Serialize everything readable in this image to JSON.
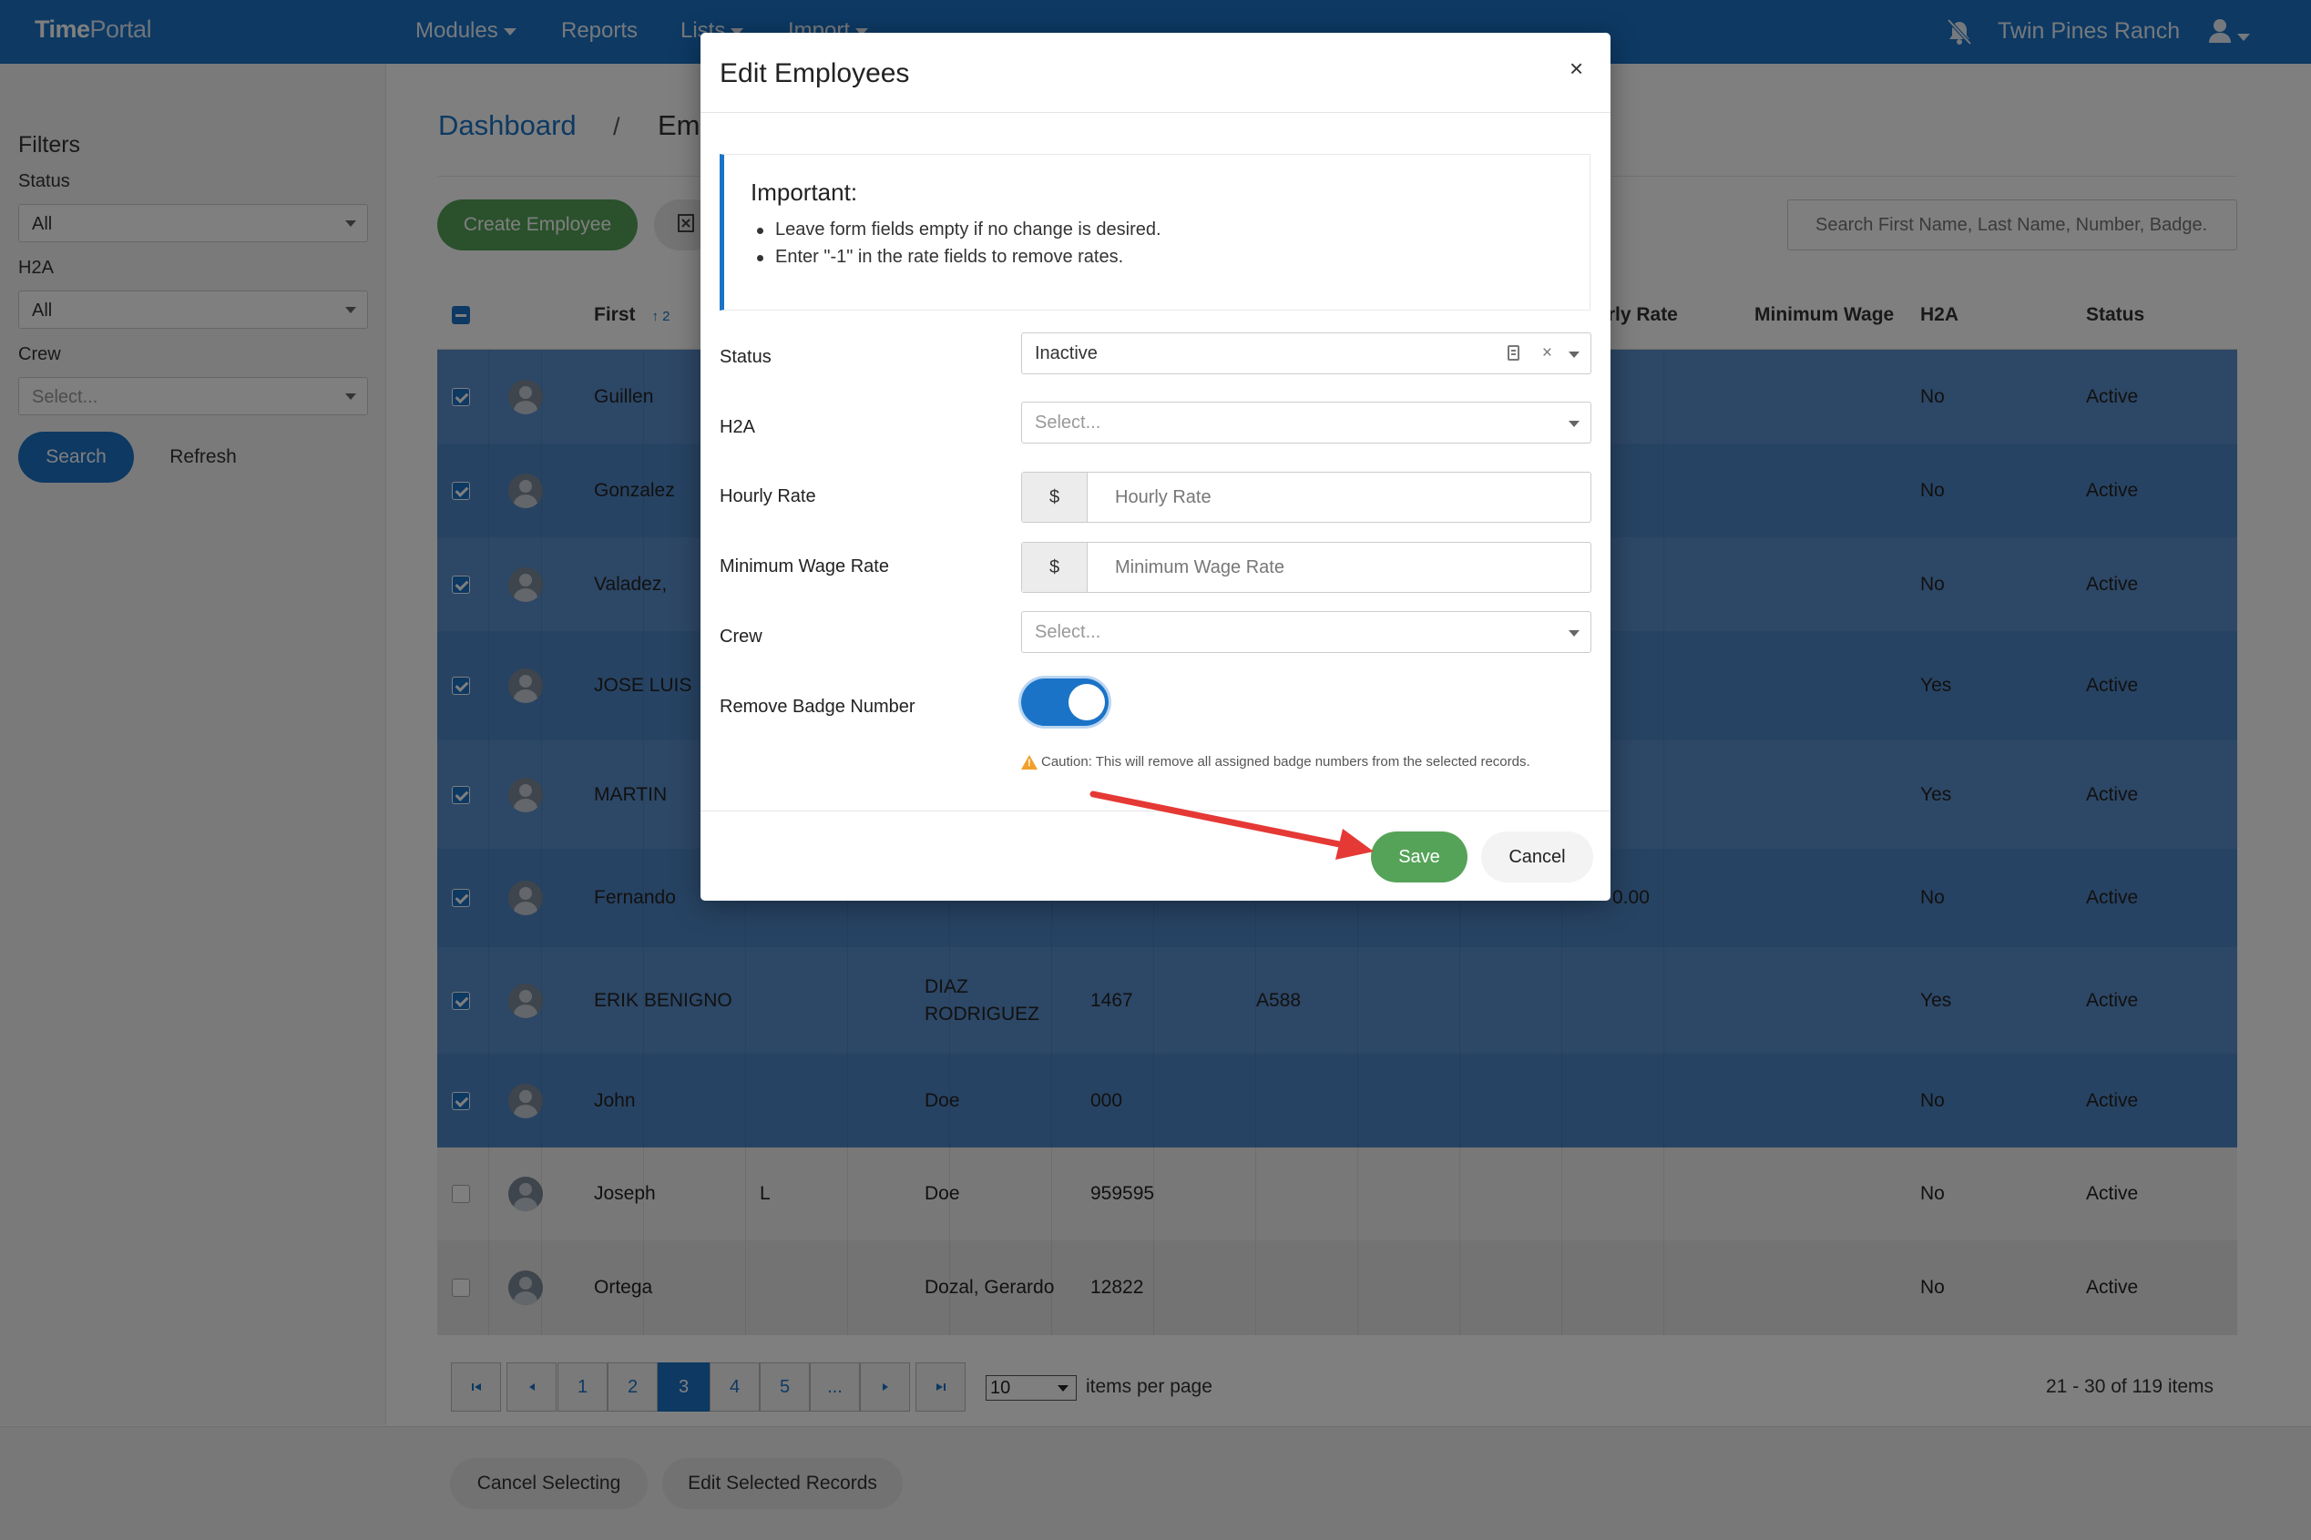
{
  "navbar": {
    "brand_a": "Time",
    "brand_b": "Portal",
    "menu": [
      "Modules",
      "Reports",
      "Lists",
      "Import"
    ],
    "org_name": "Twin Pines Ranch",
    "icons": [
      "bell-off-icon",
      "user-icon"
    ]
  },
  "sidebar": {
    "title": "Filters",
    "status_label": "Status",
    "status_value": "All",
    "h2a_label": "H2A",
    "h2a_value": "All",
    "crew_label": "Crew",
    "crew_placeholder": "Select...",
    "search_button": "Search",
    "refresh_button": "Refresh"
  },
  "breadcrumb": {
    "root": "Dashboard",
    "separator": "/",
    "current": "Em"
  },
  "toolbar": {
    "create_button": "Create Employee",
    "search_placeholder": "Search First Name, Last Name, Number, Badge..."
  },
  "grid": {
    "headers": {
      "first": "First",
      "sort_indicator": "↑ 2",
      "hourly_rate_partial": "urly Rate",
      "min_wage": "Minimum Wage",
      "h2a": "H2A",
      "status": "Status"
    },
    "rows": [
      {
        "first": "Guillen",
        "middle": "",
        "last": "",
        "number": "",
        "badge": "",
        "hourly": "",
        "h2a": "No",
        "status": "Active",
        "selected": true
      },
      {
        "first": "Gonzalez",
        "middle": "",
        "last": "",
        "number": "",
        "badge": "",
        "hourly": "",
        "h2a": "No",
        "status": "Active",
        "selected": true
      },
      {
        "first": "Valadez,",
        "middle": "",
        "last": "",
        "number": "",
        "badge": "",
        "hourly": "",
        "h2a": "No",
        "status": "Active",
        "selected": true
      },
      {
        "first": "JOSE LUIS",
        "middle": "",
        "last": "",
        "number": "",
        "badge": "",
        "hourly": "",
        "h2a": "Yes",
        "status": "Active",
        "selected": true
      },
      {
        "first": "MARTIN",
        "middle": "",
        "last": "",
        "number": "",
        "badge": "",
        "hourly": "",
        "h2a": "Yes",
        "status": "Active",
        "selected": true
      },
      {
        "first": "Fernando",
        "middle": "",
        "last": "",
        "number": "",
        "badge": "",
        "hourly": "0.00",
        "h2a": "No",
        "status": "Active",
        "selected": true
      },
      {
        "first": "ERIK BENIGNO",
        "middle": "",
        "last": "DIAZ\nRODRIGUEZ",
        "number": "1467",
        "badge": "A588",
        "hourly": "",
        "h2a": "Yes",
        "status": "Active",
        "selected": true
      },
      {
        "first": "John",
        "middle": "",
        "last": "Doe",
        "number": "000",
        "badge": "",
        "hourly": "",
        "h2a": "No",
        "status": "Active",
        "selected": true
      },
      {
        "first": "Joseph",
        "middle": "L",
        "last": "Doe",
        "number": "959595",
        "badge": "",
        "hourly": "",
        "h2a": "No",
        "status": "Active",
        "selected": false
      },
      {
        "first": "Ortega",
        "middle": "",
        "last": "Dozal, Gerardo",
        "number": "12822",
        "badge": "",
        "hourly": "",
        "h2a": "No",
        "status": "Active",
        "selected": false
      }
    ]
  },
  "pager": {
    "first_icon": "first-page-icon",
    "prev_icon": "prev-page-icon",
    "pages": [
      "1",
      "2",
      "3",
      "4",
      "5",
      "..."
    ],
    "active_page": "3",
    "next_icon": "next-page-icon",
    "last_icon": "last-page-icon",
    "page_size": "10",
    "page_size_label": "items per page",
    "info": "21 - 30 of 119 items"
  },
  "footer": {
    "cancel_selecting": "Cancel Selecting",
    "edit_selected": "Edit Selected Records"
  },
  "modal": {
    "title": "Edit Employees",
    "close": "×",
    "important_title": "Important:",
    "important_items": [
      "Leave form fields empty if no change is desired.",
      "Enter \"-1\" in the rate fields to remove rates."
    ],
    "status_label": "Status",
    "status_value": "Inactive",
    "status_clear": "×",
    "h2a_label": "H2A",
    "h2a_placeholder": "Select...",
    "hourly_label": "Hourly Rate",
    "hourly_addon": "$",
    "hourly_placeholder": "Hourly Rate",
    "minwage_label": "Minimum Wage Rate",
    "minwage_addon": "$",
    "minwage_placeholder": "Minimum Wage Rate",
    "crew_label": "Crew",
    "crew_placeholder": "Select...",
    "remove_badge_label": "Remove Badge Number",
    "remove_badge_on": true,
    "caution": "Caution: This will remove all assigned badge numbers from the selected records.",
    "save_button": "Save",
    "cancel_button": "Cancel"
  },
  "colors": {
    "primary": "#1a73c7",
    "success": "#55a358",
    "annotation_arrow": "#e53935"
  }
}
